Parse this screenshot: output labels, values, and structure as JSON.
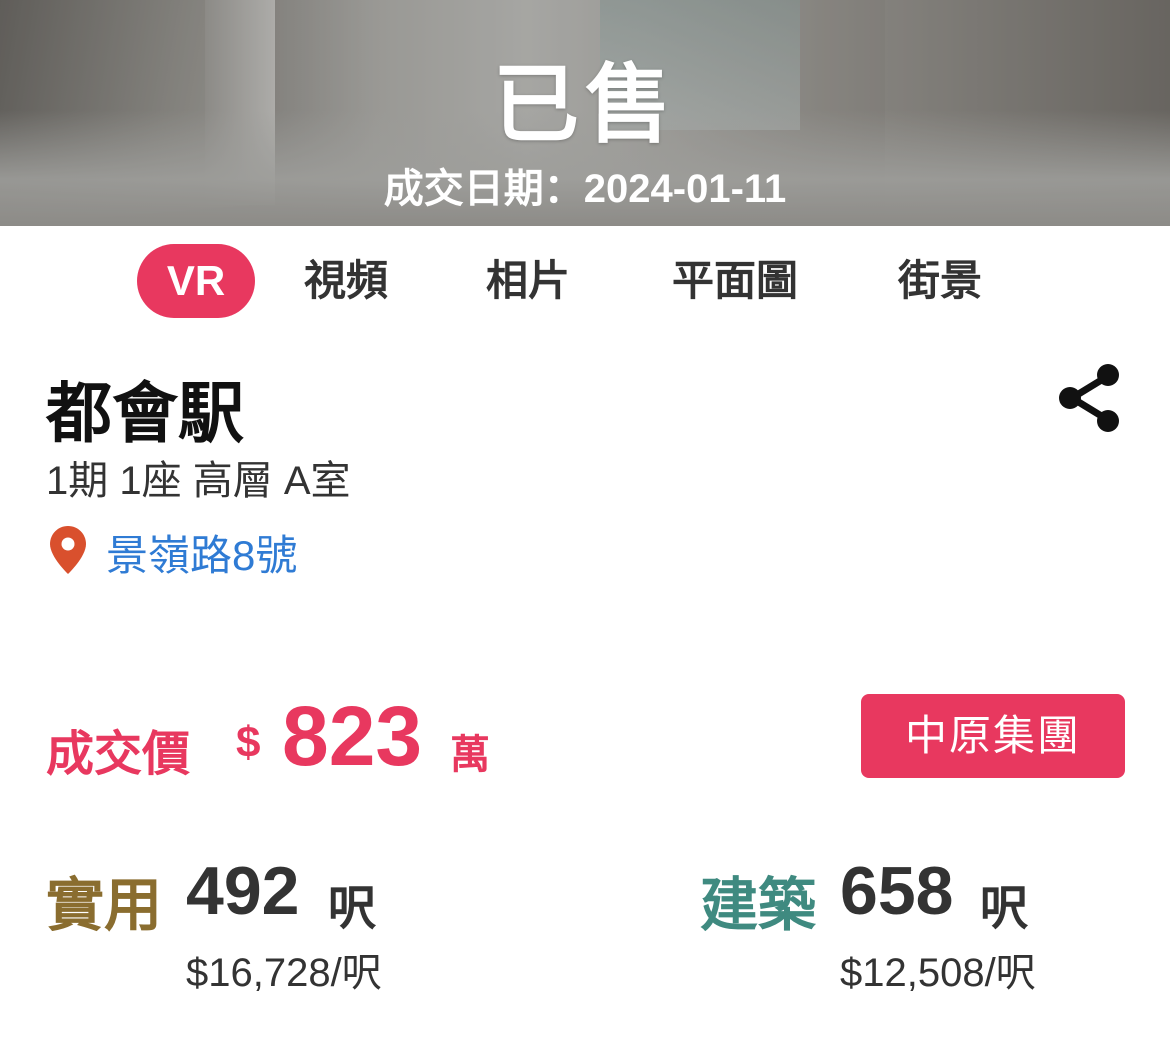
{
  "hero": {
    "status": "已售",
    "deal_date": "成交日期：2024-01-11"
  },
  "tabs": [
    {
      "label": "VR",
      "active": true
    },
    {
      "label": "視頻",
      "active": false
    },
    {
      "label": "相片",
      "active": false
    },
    {
      "label": "平面圖",
      "active": false
    },
    {
      "label": "街景",
      "active": false
    }
  ],
  "property": {
    "name": "都會駅",
    "unit": "1期 1座 高層 A室",
    "address": "景嶺路8號"
  },
  "price": {
    "label": "成交價",
    "currency": "$",
    "value": "823",
    "unit": "萬",
    "agency": "中原集團"
  },
  "saleable_area": {
    "label": "實用",
    "value": "492",
    "unit": "呎",
    "price_per_sqft": "$16,728/呎"
  },
  "gross_area": {
    "label": "建築",
    "value": "658",
    "unit": "呎",
    "price_per_sqft": "$12,508/呎"
  },
  "colors": {
    "accent": "#e8385f",
    "link": "#2f7bd4",
    "saleable": "#8a6d2f",
    "gross": "#3f8a80",
    "pin": "#d9502d"
  },
  "icons": {
    "share": "share-icon",
    "location": "location-pin-icon"
  }
}
